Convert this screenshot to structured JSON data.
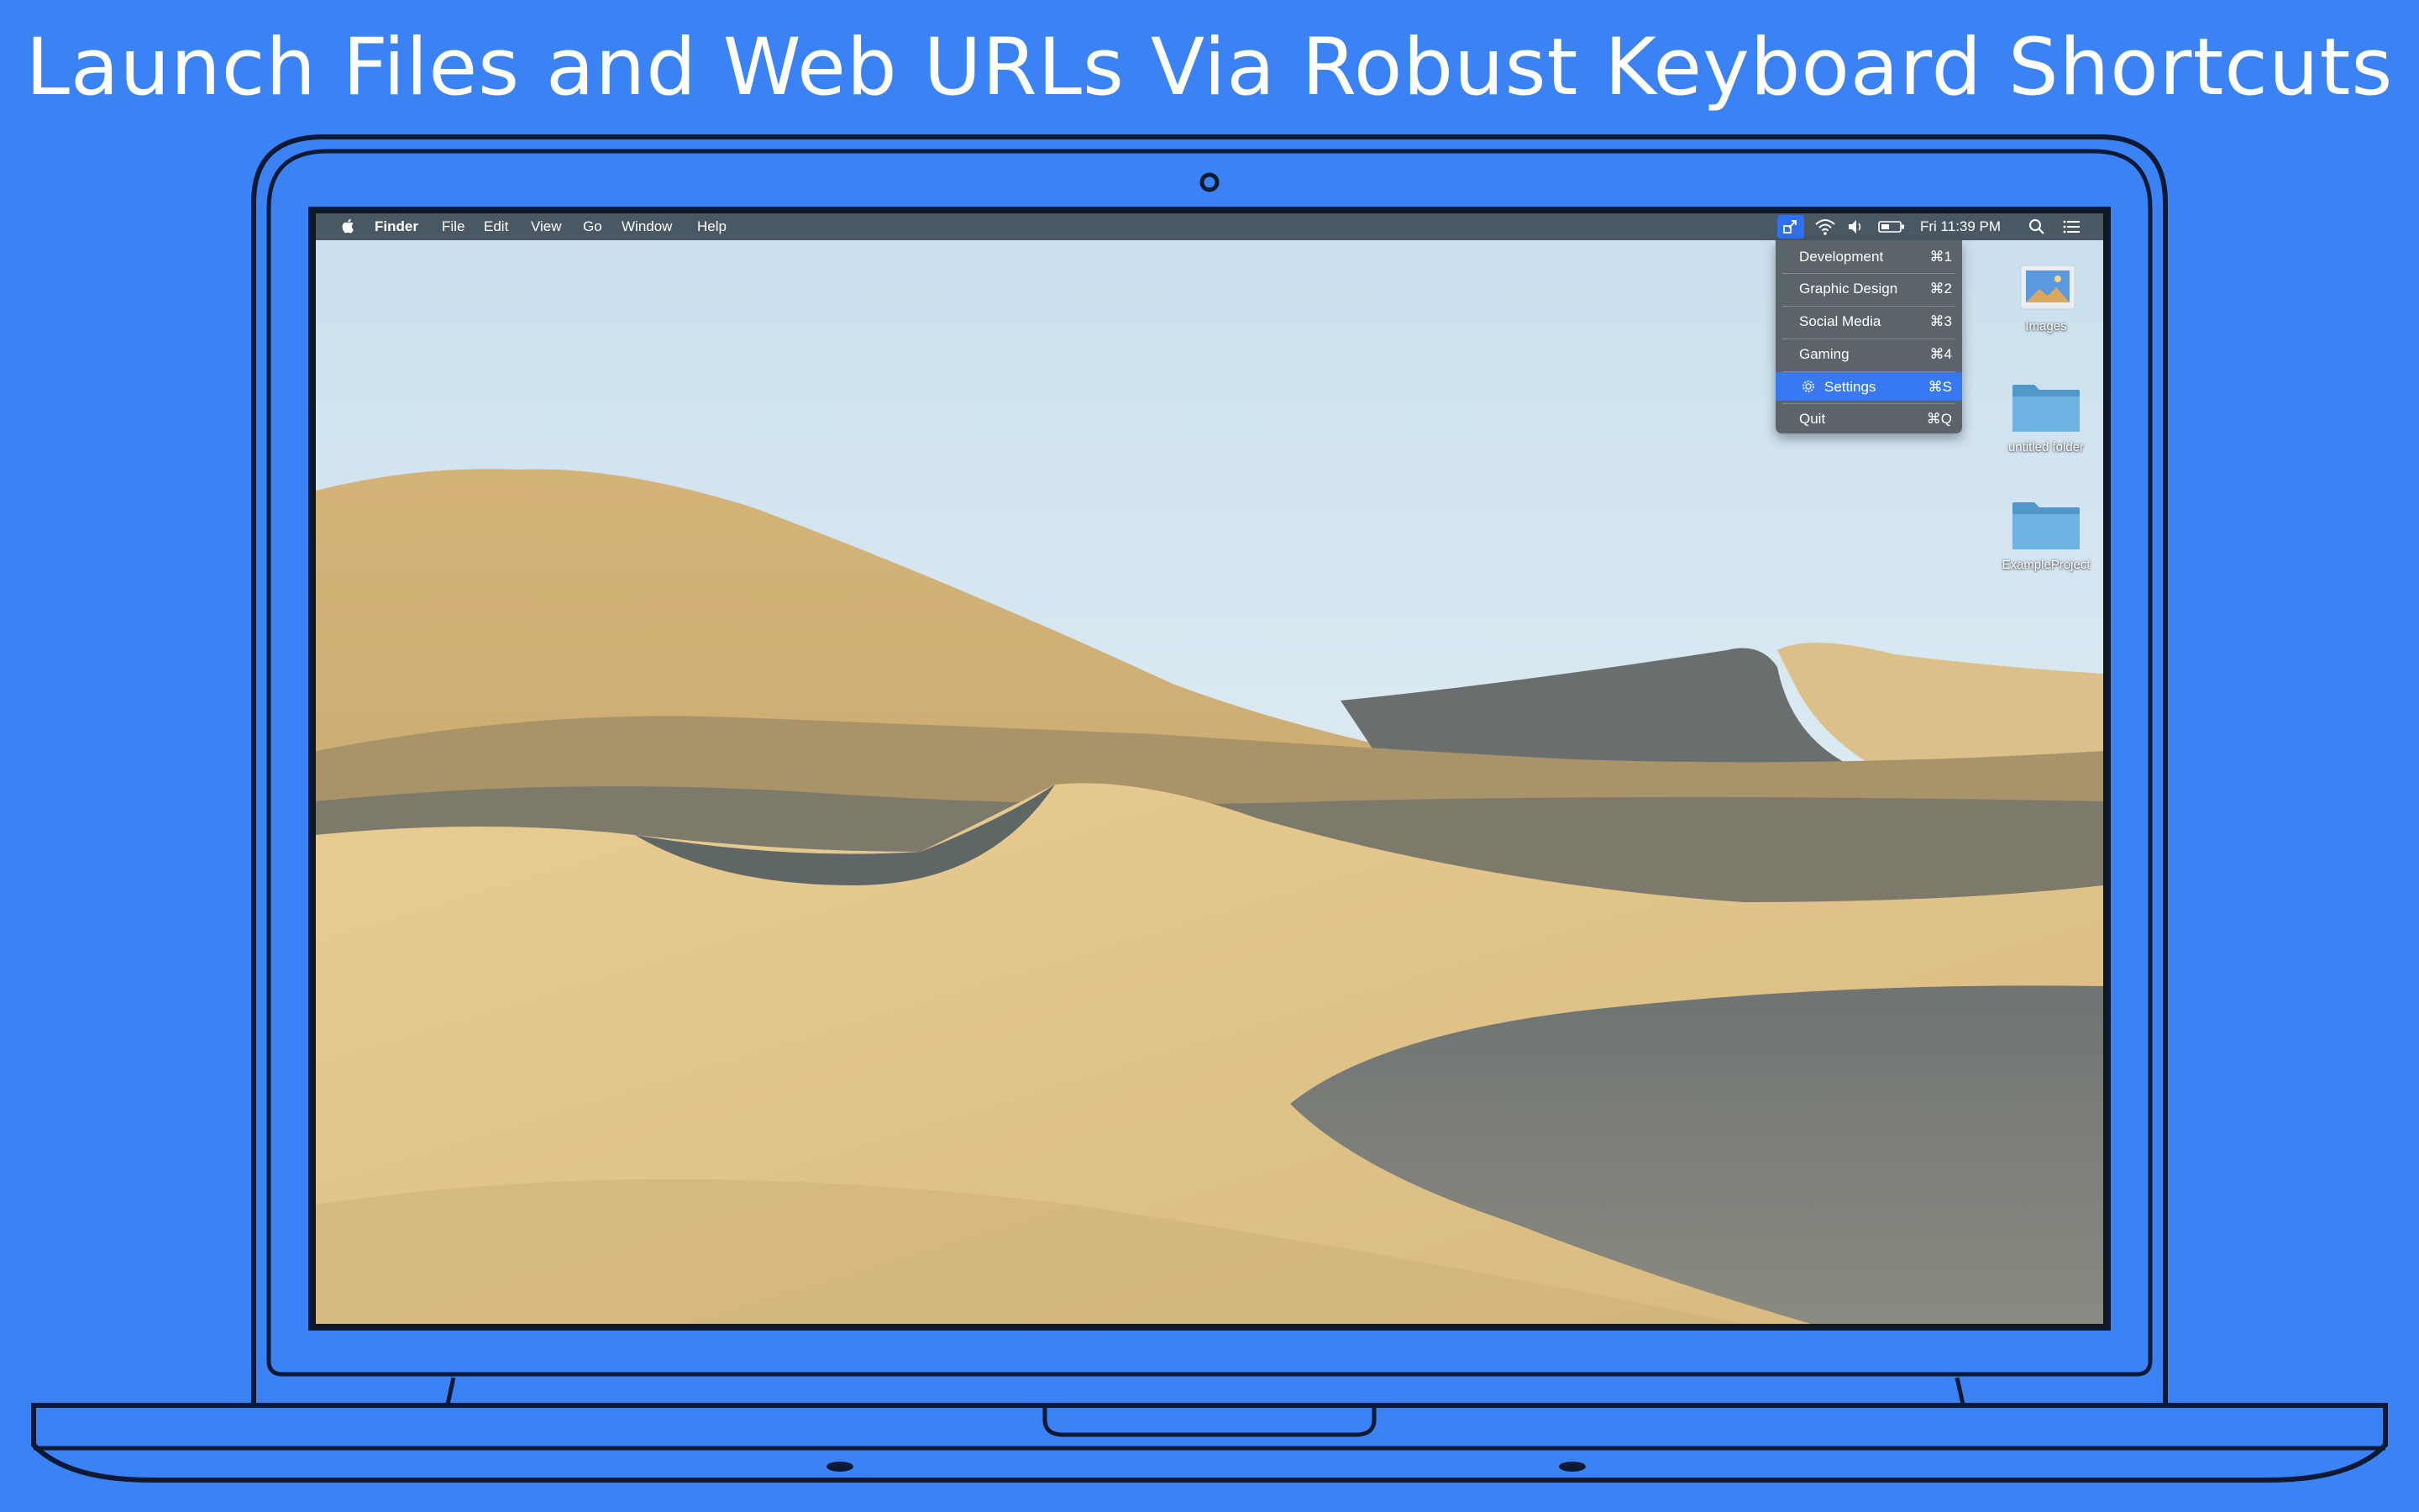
{
  "headline": "Launch Files and Web URLs Via Robust Keyboard Shortcuts",
  "colors": {
    "background": "#3b83f4",
    "laptop_outline": "#0e1a33",
    "menubar": "#4a5863",
    "menu_bg": "#5b646b",
    "menu_selected": "#3879f2"
  },
  "menubar": {
    "app_name": "Finder",
    "menus": [
      "File",
      "Edit",
      "View",
      "Go",
      "Window",
      "Help"
    ],
    "clock": "Fri 11:39 PM",
    "status_icons": [
      "app-shortcut-icon",
      "wifi-icon",
      "volume-icon",
      "battery-icon",
      "search-icon",
      "list-icon"
    ]
  },
  "dropdown": {
    "items": [
      {
        "label": "Development",
        "shortcut": "⌘1"
      },
      {
        "label": "Graphic Design",
        "shortcut": "⌘2"
      },
      {
        "label": "Social Media",
        "shortcut": "⌘3"
      },
      {
        "label": "Gaming",
        "shortcut": "⌘4"
      },
      {
        "label": "Settings",
        "shortcut": "⌘S",
        "icon": "gear-icon",
        "selected": true
      },
      {
        "label": "Quit",
        "shortcut": "⌘Q"
      }
    ]
  },
  "desktop_icons": [
    {
      "label": "Images",
      "icon": "image-file-icon"
    },
    {
      "label": "untitled folder",
      "icon": "folder-icon"
    },
    {
      "label": "ExampleProject",
      "icon": "folder-icon"
    }
  ]
}
